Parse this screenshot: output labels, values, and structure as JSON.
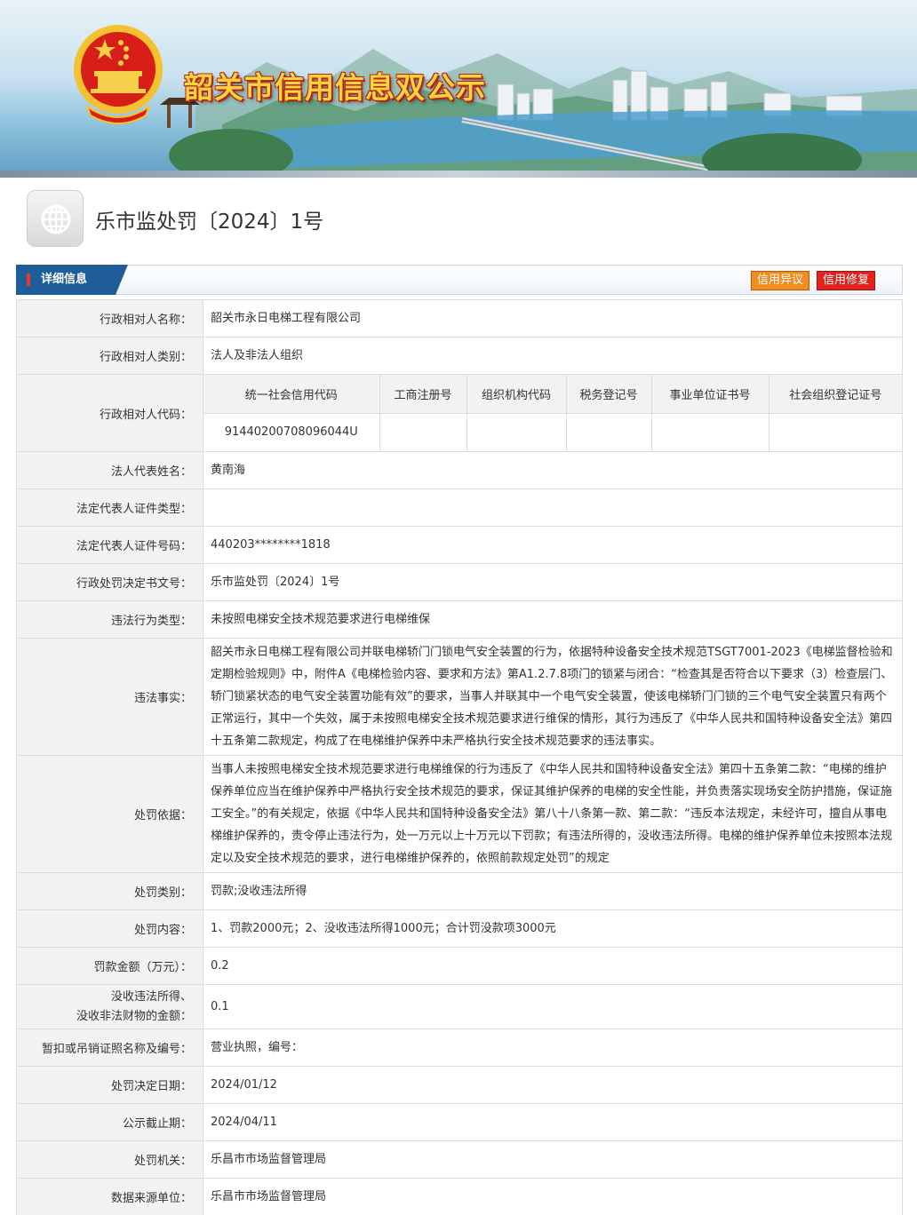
{
  "banner": {
    "title": "韶关市信用信息双公示",
    "colors": {
      "title": "#ffd33a",
      "outline": "#b0241c"
    },
    "emblem_icon": "national-emblem-icon"
  },
  "page": {
    "title": "乐市监处罚〔2024〕1号",
    "title_icon": "globe-icon"
  },
  "section": {
    "label": "详细信息",
    "buttons": {
      "objection": "信用异议",
      "repair": "信用修复"
    },
    "colors": {
      "tab": "#1f5d98",
      "objection": "#f08d1e",
      "repair": "#e0231c"
    }
  },
  "details": {
    "party_name": {
      "label": "行政相对人名称：",
      "value": "韶关市永日电梯工程有限公司"
    },
    "party_type": {
      "label": "行政相对人类别：",
      "value": "法人及非法人组织"
    },
    "party_code": {
      "label": "行政相对人代码：",
      "headers": [
        "统一社会信用代码",
        "工商注册号",
        "组织机构代码",
        "税务登记号",
        "事业单位证书号",
        "社会组织登记证号"
      ],
      "values": [
        "91440200708096044U",
        "",
        "",
        "",
        "",
        ""
      ]
    },
    "legal_rep": {
      "label": "法人代表姓名：",
      "value": "黄南海"
    },
    "legal_rep_id_type": {
      "label": "法定代表人证件类型：",
      "value": ""
    },
    "legal_rep_id_no": {
      "label": "法定代表人证件号码：",
      "value": "440203********1818"
    },
    "decision_no": {
      "label": "行政处罚决定书文号：",
      "value": "乐市监处罚〔2024〕1号"
    },
    "violation_type": {
      "label": "违法行为类型：",
      "value": "未按照电梯安全技术规范要求进行电梯维保"
    },
    "facts": {
      "label": "违法事实：",
      "value": "韶关市永日电梯工程有限公司并联电梯轿门门锁电气安全装置的行为，依据特种设备安全技术规范TSGT7001-2023《电梯监督检验和定期检验规则》中，附件A《电梯检验内容、要求和方法》第A1.2.7.8项门的锁紧与闭合：“检查其是否符合以下要求（3）检查层门、轿门锁紧状态的电气安全装置功能有效”的要求，当事人并联其中一个电气安全装置，使该电梯轿门门锁的三个电气安全装置只有两个正常运行，其中一个失效，属于未按照电梯安全技术规范要求进行维保的情形，其行为违反了《中华人民共和国特种设备安全法》第四十五条第二款规定，构成了在电梯维护保养中未严格执行安全技术规范要求的违法事实。"
    },
    "basis": {
      "label": "处罚依据：",
      "value": "当事人未按照电梯安全技术规范要求进行电梯维保的行为违反了《中华人民共和国特种设备安全法》第四十五条第二款：“电梯的维护保养单位应当在维护保养中严格执行安全技术规范的要求，保证其维护保养的电梯的安全性能，并负责落实现场安全防护措施，保证施工安全。”的有关规定，依据《中华人民共和国特种设备安全法》第八十八条第一款、第二款：“违反本法规定，未经许可，擅自从事电梯维护保养的，责令停止违法行为，处一万元以上十万元以下罚款；有违法所得的，没收违法所得。电梯的维护保养单位未按照本法规定以及安全技术规范的要求，进行电梯维护保养的，依照前款规定处罚”的规定"
    },
    "penalty_type": {
      "label": "处罚类别：",
      "value": "罚款;没收违法所得"
    },
    "penalty_content": {
      "label": "处罚内容：",
      "value": "1、罚款2000元；2、没收违法所得1000元；合计罚没款项3000元"
    },
    "fine_amount": {
      "label": "罚款金额（万元）：",
      "value": "0.2"
    },
    "confiscation": {
      "label_line1": "没收违法所得、",
      "label_line2": "没收非法财物的金额：",
      "value": "0.1"
    },
    "license_revoke": {
      "label": "暂扣或吊销证照名称及编号：",
      "value": "营业执照，编号："
    },
    "decision_date": {
      "label": "处罚决定日期：",
      "value": "2024/01/12"
    },
    "public_deadline": {
      "label": "公示截止期：",
      "value": "2024/04/11"
    },
    "authority": {
      "label": "处罚机关：",
      "value": "乐昌市市场监督管理局"
    },
    "source_unit": {
      "label": "数据来源单位：",
      "value": "乐昌市市场监督管理局"
    }
  }
}
